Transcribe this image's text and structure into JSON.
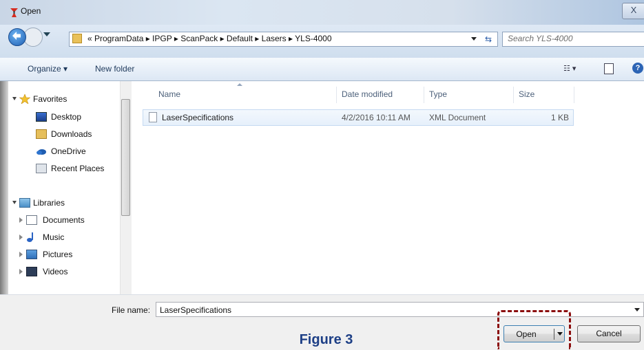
{
  "window": {
    "title": "Open",
    "close_label": "X"
  },
  "address": {
    "breadcrumb": "« ProgramData ▸ IPGP ▸ ScanPack ▸ Default ▸ Lasers ▸ YLS-4000",
    "search_placeholder": "Search YLS-4000"
  },
  "toolbar": {
    "organize": "Organize ▾",
    "new_folder": "New folder",
    "help": "?"
  },
  "sidebar": {
    "favorites": {
      "label": "Favorites",
      "items": [
        "Desktop",
        "Downloads",
        "OneDrive",
        "Recent Places"
      ]
    },
    "libraries": {
      "label": "Libraries",
      "items": [
        "Documents",
        "Music",
        "Pictures",
        "Videos"
      ]
    }
  },
  "file_list": {
    "columns": [
      "Name",
      "Date modified",
      "Type",
      "Size"
    ],
    "rows": [
      {
        "name": "LaserSpecifications",
        "date": "4/2/2016 10:11 AM",
        "type": "XML Document",
        "size": "1 KB"
      }
    ]
  },
  "footer": {
    "file_name_label": "File name:",
    "file_name_value": "LaserSpecifications",
    "open_label": "Open",
    "cancel_label": "Cancel"
  },
  "caption": "Figure 3",
  "colors": {
    "highlight": "#8b0d0d",
    "caption": "#1d3f86",
    "accent": "#3c7fb1"
  },
  "icons": [
    "app-icon",
    "back-icon",
    "forward-icon",
    "folder-icon",
    "refresh-icon",
    "search-icon",
    "views-icon",
    "preview-pane-icon",
    "help-icon",
    "star-icon",
    "desktop-icon",
    "downloads-icon",
    "onedrive-icon",
    "recent-places-icon",
    "libraries-icon",
    "documents-icon",
    "music-icon",
    "pictures-icon",
    "videos-icon",
    "xml-file-icon"
  ]
}
